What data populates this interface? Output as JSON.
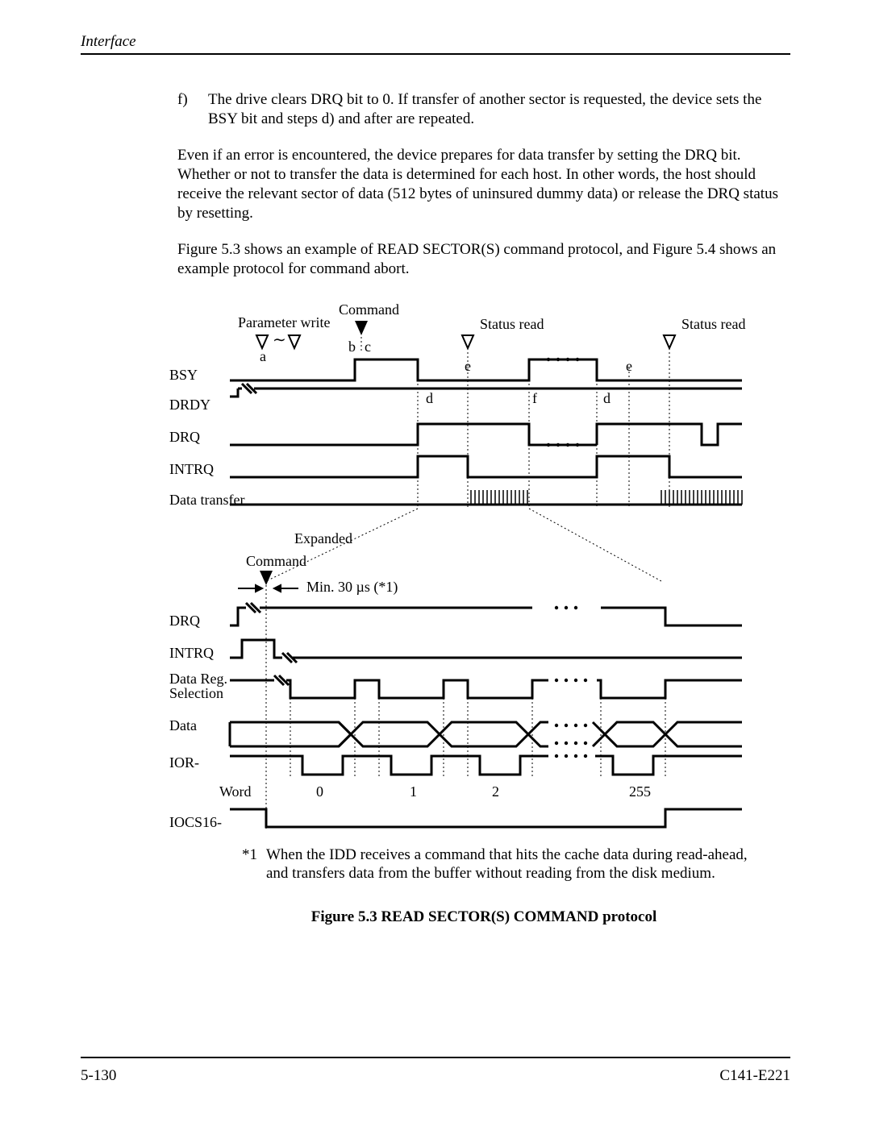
{
  "header": {
    "section": "Interface"
  },
  "body": {
    "item_f_marker": "f)",
    "item_f_text": "The drive clears DRQ bit to 0.  If transfer of another sector is requested, the device sets the BSY bit and steps d) and after are repeated.",
    "para1": "Even if an error is encountered, the device prepares for data transfer by setting the DRQ bit.  Whether or not to transfer the data is determined for each host.  In other words, the host should receive the relevant sector of data (512 bytes of uninsured dummy data) or release the DRQ status by resetting.",
    "para2": "Figure 5.3 shows an example of READ SECTOR(S) command protocol, and Figure 5.4 shows an example protocol for command abort."
  },
  "diagram": {
    "top": {
      "parameter_write": "Parameter write",
      "command": "Command",
      "status_read": "Status read",
      "a": "a",
      "b": "b",
      "c": "c",
      "d": "d",
      "e": "e",
      "f": "f",
      "tilde": "∼",
      "signals": {
        "BSY": "BSY",
        "DRDY": "DRDY",
        "DRQ": "DRQ",
        "INTRQ": "INTRQ",
        "DataTransfer": "Data transfer"
      }
    },
    "expanded": {
      "label": "Expanded",
      "command": "Command",
      "min30": "Min. 30 µs (*1)",
      "signals": {
        "DRQ": "DRQ",
        "INTRQ": "INTRQ",
        "DataRegSel": "Data Reg.\nSelection",
        "Data": "Data",
        "IOR": "IOR-",
        "Word": "Word",
        "IOCS16": "IOCS16-"
      },
      "words": [
        "0",
        "1",
        "2",
        "255"
      ]
    }
  },
  "footnote": {
    "marker": "*1",
    "text": "When the IDD receives a command that hits the cache data during read-ahead, and transfers data from the buffer without reading from the disk medium."
  },
  "caption": "Figure 5.3  READ SECTOR(S) COMMAND protocol",
  "footer": {
    "page": "5-130",
    "doc": "C141-E221"
  }
}
